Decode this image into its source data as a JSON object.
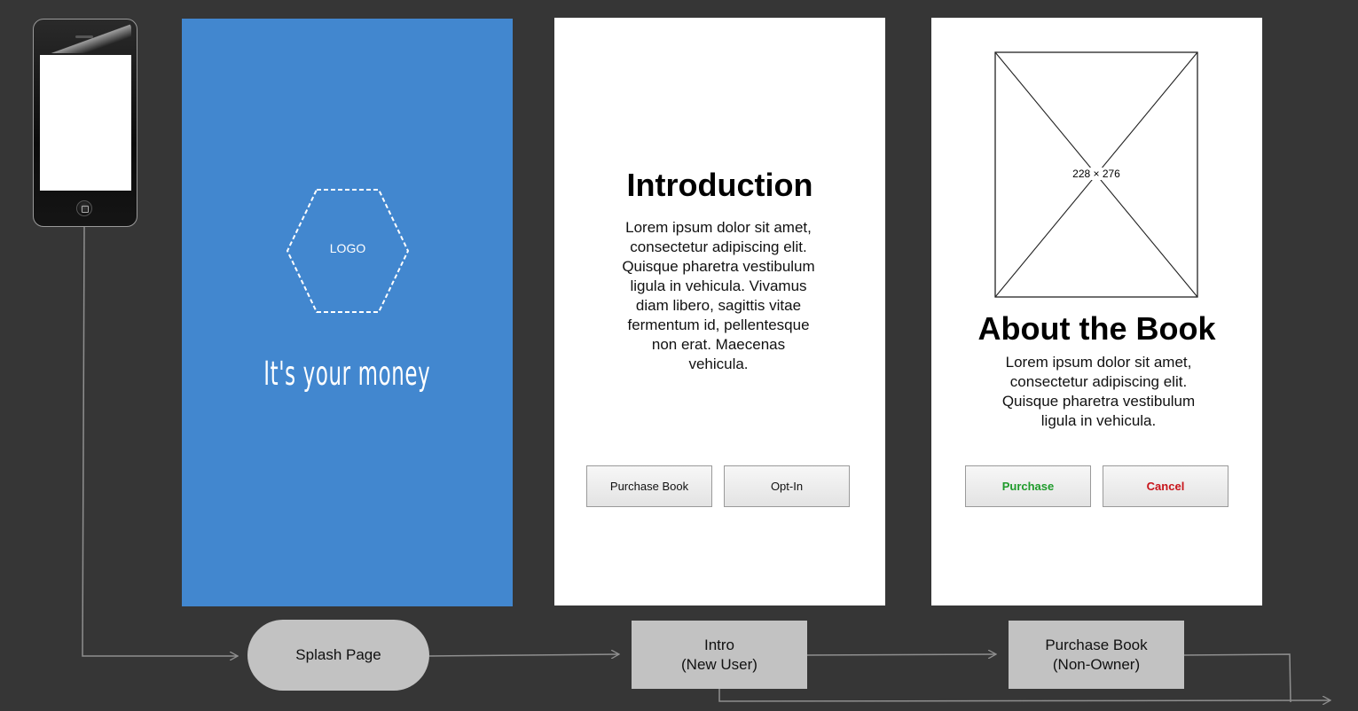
{
  "splash": {
    "logo_label": "LOGO",
    "tagline": "It's your money"
  },
  "intro": {
    "title": "Introduction",
    "body": "Lorem ipsum dolor sit amet, consectetur adipiscing elit. Quisque pharetra vestibulum ligula in vehicula. Vivamus diam libero, sagittis vitae fermentum id, pellentesque non erat. Maecenas vehicula.",
    "buttons": {
      "purchase_book": "Purchase Book",
      "opt_in": "Opt-In"
    }
  },
  "book": {
    "image_placeholder_label": "228 × 276",
    "title": "About the Book",
    "body": "Lorem ipsum dolor sit amet, consectetur adipiscing elit. Quisque pharetra vestibulum ligula in vehicula.",
    "buttons": {
      "purchase": "Purchase",
      "cancel": "Cancel"
    }
  },
  "flow": {
    "splash_node": "Splash Page",
    "intro_node": [
      "Intro",
      "(New User)"
    ],
    "purchase_node": [
      "Purchase Book",
      "(Non-Owner)"
    ]
  },
  "colors": {
    "background": "#363636",
    "splash_blue": "#4287cf",
    "flow_node": "#c2c2c2",
    "purchase_green": "#1f9b2b",
    "cancel_red": "#c8151b",
    "connector": "#8f8f8f"
  }
}
